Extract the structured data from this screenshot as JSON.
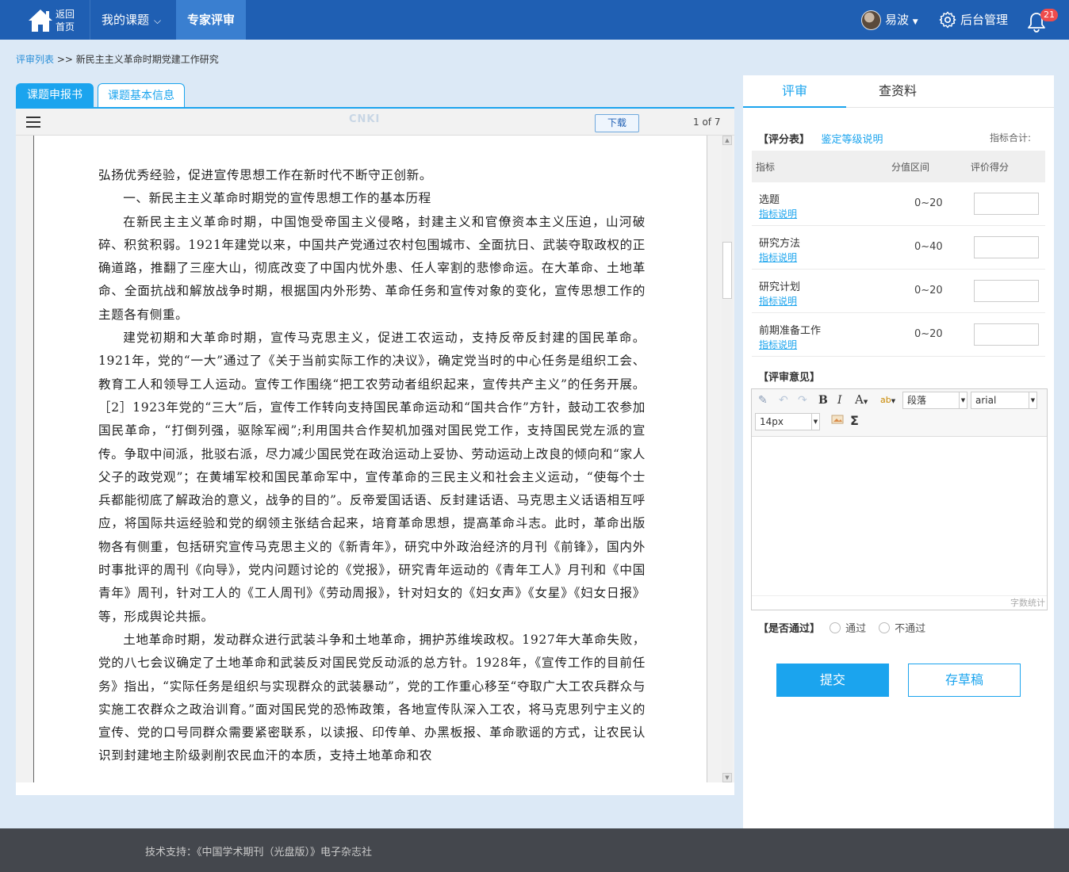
{
  "header": {
    "home_line1": "返回",
    "home_line2": "首页",
    "nav_mine": "我的课题",
    "nav_expert": "专家评审",
    "user_name": "易波",
    "admin_label": "后台管理",
    "notify_count": "21",
    "brand_color": "#1f5fb3"
  },
  "breadcrumb": {
    "link": "评审列表",
    "sep": " >> ",
    "current": "新民主主义革命时期党建工作研究"
  },
  "left_tabs": [
    "课题申报书",
    "课题基本信息"
  ],
  "viewer": {
    "logo_text": "CNKI",
    "download_label": "下载",
    "page_info": "1 of 7"
  },
  "document": {
    "paragraphs": [
      "弘扬优秀经验，促进宣传思想工作在新时代不断守正创新。",
      "一、新民主主义革命时期党的宣传思想工作的基本历程",
      "在新民主主义革命时期，中国饱受帝国主义侵略，封建主义和官僚资本主义压迫，山河破碎、积贫积弱。1921年建党以来，中国共产党通过农村包围城市、全面抗日、武装夺取政权的正确道路，推翻了三座大山，彻底改变了中国内忧外患、任人宰割的悲惨命运。在大革命、土地革命、全面抗战和解放战争时期，根据国内外形势、革命任务和宣传对象的变化，宣传思想工作的主题各有侧重。",
      "建党初期和大革命时期，宣传马克思主义，促进工农运动，支持反帝反封建的国民革命。1921年，党的“一大”通过了《关于当前实际工作的决议》，确定党当时的中心任务是组织工会、教育工人和领导工人运动。宣传工作围绕“把工农劳动者组织起来，宣传共产主义”的任务开展。［2］1923年党的“三大”后，宣传工作转向支持国民革命运动和“国共合作”方针，鼓动工农参加国民革命，“打倒列强，驱除军阀”;利用国共合作契机加强对国民党工作，支持国民党左派的宣传。争取中间派，批驳右派，尽力减少国民党在政治运动上妥协、劳动运动上改良的倾向和“家人父子的政党观”；在黄埔军校和国民革命军中，宣传革命的三民主义和社会主义运动，“使每个士兵都能彻底了解政治的意义，战争的目的”。反帝爱国话语、反封建话语、马克思主义话语相互呼应，将国际共运经验和党的纲领主张结合起来，培育革命思想，提高革命斗志。此时，革命出版物各有侧重，包括研究宣传马克思主义的《新青年》，研究中外政治经济的月刊《前锋》，国内外时事批评的周刊《向导》，党内问题讨论的《党报》，研究青年运动的《青年工人》月刊和《中国青年》周刊，针对工人的《工人周刊》《劳动周报》，针对妇女的《妇女声》《女星》《妇女日报》等，形成舆论共振。",
      "土地革命时期，发动群众进行武装斗争和土地革命，拥护苏维埃政权。1927年大革命失败，党的八七会议确定了土地革命和武装反对国民党反动派的总方针。1928年，《宣传工作的目前任务》指出，“实际任务是组织与实现群众的武装暴动”，党的工作重心移至“夺取广大工农兵群众与实施工农群众之政治训育。”面对国民党的恐怖政策，各地宣传队深入工农，将马克思列宁主义的宣传、党的口号同群众需要紧密联系，以读报、印传单、办黑板报、革命歌谣的方式，让农民认识到封建地主阶级剥削农民血汗的本质，支持土地革命和农"
    ]
  },
  "review": {
    "tab_review": "评审",
    "tab_materials": "查资料",
    "score_title": "【评分表】",
    "level_link": "鉴定等级说明",
    "total_label": "指标合计:",
    "table_headers": [
      "指标",
      "分值区间",
      "评价得分"
    ],
    "rows": [
      {
        "name": "选题",
        "explain": "指标说明",
        "range": "0~20",
        "score": ""
      },
      {
        "name": "研究方法",
        "explain": "指标说明",
        "range": "0~40",
        "score": ""
      },
      {
        "name": "研究计划",
        "explain": "指标说明",
        "range": "0~20",
        "score": ""
      },
      {
        "name": "前期准备工作",
        "explain": "指标说明",
        "range": "0~20",
        "score": ""
      }
    ],
    "opinion_title": "【评审意见】",
    "editor": {
      "paragraph_select": "段落",
      "font_select": "arial",
      "size_select": "14px",
      "word_count_label": "字数统计"
    },
    "pass_title": "【是否通过】",
    "pass_yes": "通过",
    "pass_no": "不通过",
    "submit_label": "提交",
    "draft_label": "存草稿",
    "accent_color": "#1ba4ee"
  },
  "footer": {
    "text": "技术支持：《中国学术期刊（光盘版）》电子杂志社"
  }
}
